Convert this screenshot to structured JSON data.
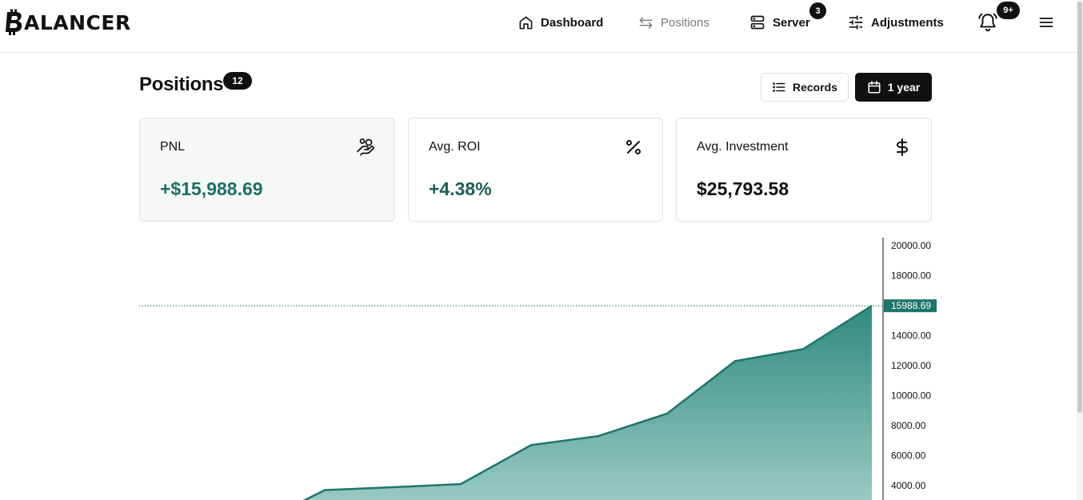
{
  "brand": {
    "name": "ALANCER",
    "logo_glyph": "bitcoin-b"
  },
  "nav": {
    "dashboard": "Dashboard",
    "positions": "Positions",
    "server": "Server",
    "server_badge": "3",
    "adjustments": "Adjustments",
    "notifications_badge": "9+"
  },
  "page": {
    "title": "Positions",
    "count_badge": "12",
    "records_button": "Records",
    "period_button": "1 year"
  },
  "cards": [
    {
      "label": "PNL",
      "value": "+$15,988.69",
      "icon": "hand-coins-icon",
      "color": "#1b6f66"
    },
    {
      "label": "Avg. ROI",
      "value": "+4.38%",
      "icon": "percent-icon",
      "color": "#1b5e57"
    },
    {
      "label": "Avg. Investment",
      "value": "$25,793.58",
      "icon": "dollar-icon",
      "color": "#111111"
    }
  ],
  "chart_data": {
    "type": "area",
    "y_ticks": [
      "20000.00",
      "18000.00",
      "14000.00",
      "12000.00",
      "10000.00",
      "8000.00",
      "6000.00",
      "4000.00"
    ],
    "current_value_label": "15988.69",
    "current_value": 15988.69,
    "ylim": [
      4000,
      20000
    ],
    "points": [
      1500,
      3700,
      3900,
      4100,
      6700,
      7300,
      8800,
      12300,
      13100,
      15988.69
    ],
    "line_color": "#1e756b",
    "fill_top_color": "#2f8a80",
    "fill_bottom_color": "#a5d1ca"
  }
}
